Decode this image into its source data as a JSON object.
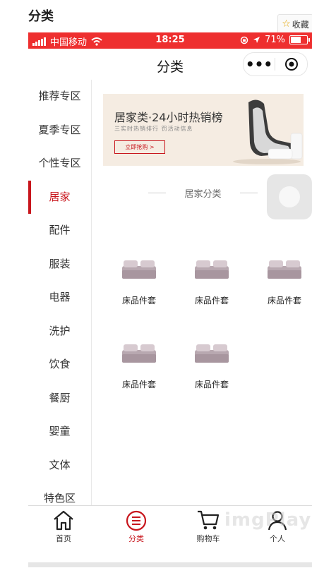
{
  "page": {
    "heading": "分类",
    "favorite_label": "收藏"
  },
  "statusbar": {
    "carrier": "中国移动",
    "time": "18:25",
    "battery": "71%",
    "battery_level": 0.71
  },
  "navbar": {
    "title": "分类"
  },
  "sidebar": {
    "active_index": 3,
    "items": [
      {
        "label": "推荐专区"
      },
      {
        "label": "夏季专区"
      },
      {
        "label": "个性专区"
      },
      {
        "label": "居家"
      },
      {
        "label": "配件"
      },
      {
        "label": "服装"
      },
      {
        "label": "电器"
      },
      {
        "label": "洗护"
      },
      {
        "label": "饮食"
      },
      {
        "label": "餐厨"
      },
      {
        "label": "婴童"
      },
      {
        "label": "文体"
      },
      {
        "label": "特色区"
      }
    ]
  },
  "banner": {
    "title": "居家类·24小时热销榜",
    "subtitle": "三实时热销排行 罚活动信息",
    "cta": "立即抢购 >"
  },
  "section": {
    "title": "居家分类"
  },
  "products": [
    {
      "name": "床品件套"
    },
    {
      "name": "床品件套"
    },
    {
      "name": "床品件套"
    },
    {
      "name": "床品件套"
    },
    {
      "name": "床品件套"
    }
  ],
  "tabbar": {
    "active": "分类",
    "tabs": [
      {
        "label": "首页",
        "icon": "home-icon"
      },
      {
        "label": "分类",
        "icon": "category-icon"
      },
      {
        "label": "购物车",
        "icon": "cart-icon"
      },
      {
        "label": "个人",
        "icon": "user-icon"
      }
    ]
  },
  "watermark": "imgPlay",
  "colors": {
    "accent": "#c8161d",
    "statusbar": "#ee2f2f"
  }
}
